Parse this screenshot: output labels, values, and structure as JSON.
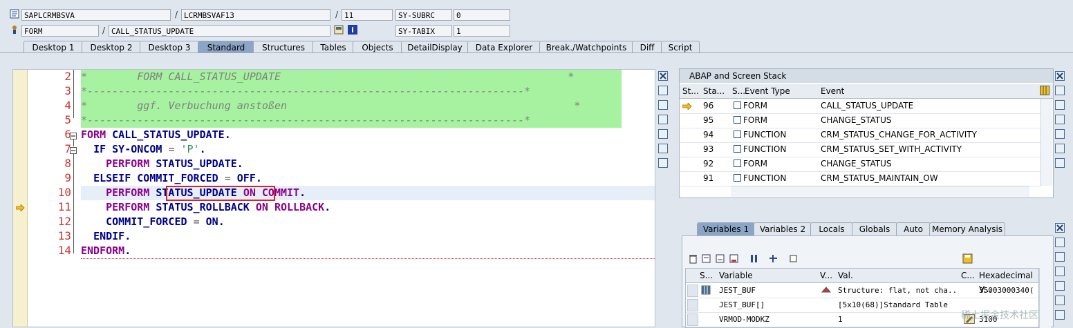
{
  "header": {
    "program": "SAPLCRMBSVA",
    "include": "LCRMBSVAF13",
    "line": "11",
    "event_type": "FORM",
    "event_name": "CALL_STATUS_UPDATE",
    "sysfield1_label": "SY-SUBRC",
    "sysfield1_value": "0",
    "sysfield2_label": "SY-TABIX",
    "sysfield2_value": "1"
  },
  "tabs": [
    "Desktop 1",
    "Desktop 2",
    "Desktop 3",
    "Standard",
    "Structures",
    "Tables",
    "Objects",
    "DetailDisplay",
    "Data Explorer",
    "Break./Watchpoints",
    "Diff",
    "Script"
  ],
  "active_tab": "Standard",
  "code": {
    "line_numbers": [
      "2",
      "3",
      "4",
      "5",
      "6",
      "7",
      "8",
      "9",
      "10",
      "11",
      "12",
      "13",
      "14"
    ],
    "current_line": "11",
    "lines": [
      {
        "c": "*        FORM CALL_STATUS_UPDATE                                              *"
      },
      {
        "c": "*----------------------------------------------------------------------*"
      },
      {
        "c": "*        ggf. Verbuchung anstoßen                                              *"
      },
      {
        "c": "*----------------------------------------------------------------------*"
      }
    ],
    "l6_kw": "FORM",
    "l6_name": "CALL_STATUS_UPDATE",
    "l6_end": ".",
    "l7_kw": "IF",
    "l7_a": "SY-ONCOM",
    "l7_op": "=",
    "l7_str": "'P'",
    "l7_end": ".",
    "l8_kw": "PERFORM",
    "l8_name": "STATUS_UPDATE",
    "l8_end": ".",
    "l9_kw": "ELSEIF",
    "l9_a": "COMMIT_FORCED",
    "l9_op": "=",
    "l9_b": "OFF",
    "l9_end": ".",
    "l10_kw": "PERFORM",
    "l10_name": "STATUS_UPDATE",
    "l10_kw2": "ON COMMIT",
    "l10_end": ".",
    "l11_kw": "PERFORM",
    "l11_name": "STATUS_ROLLBACK",
    "l11_kw2": "ON ROLLBACK",
    "l11_end": ".",
    "l12_a": "COMMIT_FORCED",
    "l12_op": "=",
    "l12_b": "ON",
    "l12_end": ".",
    "l13_kw": "ENDIF",
    "l13_end": ".",
    "l14_kw": "ENDFORM",
    "l14_end": "."
  },
  "stack": {
    "title": "ABAP and Screen Stack",
    "columns": [
      "St...",
      "Sta...",
      "S...",
      "Event Type",
      "Event"
    ],
    "rows": [
      {
        "level": "96",
        "type": "FORM",
        "event": "CALL_STATUS_UPDATE"
      },
      {
        "level": "95",
        "type": "FORM",
        "event": "CHANGE_STATUS"
      },
      {
        "level": "94",
        "type": "FUNCTION",
        "event": "CRM_STATUS_CHANGE_FOR_ACTIVITY"
      },
      {
        "level": "93",
        "type": "FUNCTION",
        "event": "CRM_STATUS_SET_WITH_ACTIVITY"
      },
      {
        "level": "92",
        "type": "FORM",
        "event": "CHANGE_STATUS"
      },
      {
        "level": "91",
        "type": "FUNCTION",
        "event": "CRM_STATUS_MAINTAIN_OW"
      }
    ]
  },
  "var_tabs": [
    "Variables 1",
    "Variables 2",
    "Locals",
    "Globals",
    "Auto",
    "Memory Analysis"
  ],
  "active_var_tab": "Variables 1",
  "variables": {
    "columns": [
      "S...",
      "Variable",
      "V...",
      "Val.",
      "C...",
      "Hexadecimal V..."
    ],
    "rows": [
      {
        "name": "JEST_BUF",
        "val": "Structure: flat, not cha...",
        "hex": "35003000340("
      },
      {
        "name": "JEST_BUF[]",
        "val": "[5x10(68)]Standard Table",
        "hex": ""
      },
      {
        "name": "VRMOD-MODKZ",
        "val": "1",
        "hex": "3100"
      }
    ]
  },
  "watermark": "稀土掘金技术社区"
}
